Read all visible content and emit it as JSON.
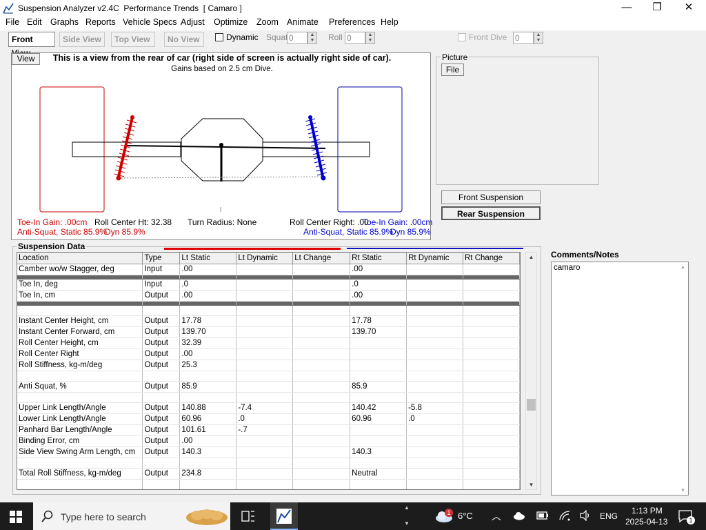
{
  "window": {
    "title": "Suspension Analyzer v2.4C  Performance Trends  [ Camaro ]",
    "minimize_glyph": "—",
    "maximize_glyph": "❐",
    "close_glyph": "✕"
  },
  "menu": [
    "File",
    "Edit",
    "Graphs",
    "Reports",
    "Vehicle Specs",
    "Adjust",
    "Optimize",
    "Zoom",
    "Animate",
    "Preferences",
    "Help"
  ],
  "toolbar": {
    "view_tabs": [
      "Front View",
      "Side View",
      "Top View",
      "No View"
    ],
    "active_view": "Front View",
    "dynamic_label": "Dynamic",
    "dynamic_checked": false,
    "squat_label": "Squat",
    "squat_value": "0",
    "roll_label": "Roll",
    "roll_value": "0",
    "front_dive_label": "Front Dive",
    "front_dive_value": "0"
  },
  "diagram": {
    "view_button": "View",
    "heading": "This is a view from the rear of car (right side of screen is actually right side of car).",
    "subheading": "Gains based on 2.5 cm Dive.",
    "left_toe_gain": "Toe-In Gain: .00cm",
    "roll_center_ht": "Roll Center Ht: 32.38",
    "turn_radius": "Turn Radius: None",
    "roll_center_right": "Roll Center Right: .00",
    "right_toe_gain": "Toe-In Gain: .00cm",
    "left_anti_squat": "Anti-Squat, Static 85.9%",
    "left_dyn": "Dyn 85.9%",
    "right_anti_squat": "Anti-Squat, Static 85.9%",
    "right_dyn": "Dyn 85.9%",
    "left_color": "#cc0000",
    "right_color": "#0000cc"
  },
  "picture": {
    "label": "Picture",
    "file_button": "File"
  },
  "buttons": {
    "front_suspension": "Front Suspension",
    "rear_suspension": "Rear Suspension"
  },
  "suspension_data": {
    "title": "Suspension Data",
    "columns": [
      "Location",
      "Type",
      "Lt Static",
      "Lt Dynamic",
      "Lt Change",
      "Rt Static",
      "Rt Dynamic",
      "Rt Change"
    ],
    "rows": [
      {
        "kind": "data",
        "cells": [
          "Camber wo/w Stagger, deg",
          "Input",
          ".00",
          "",
          "",
          ".00",
          "",
          ""
        ]
      },
      {
        "kind": "divider"
      },
      {
        "kind": "data",
        "cells": [
          "Toe In, deg",
          "Input",
          ".0",
          "",
          "",
          ".0",
          "",
          ""
        ]
      },
      {
        "kind": "data",
        "cells": [
          "Toe In, cm",
          "Output",
          ".00",
          "",
          "",
          ".00",
          "",
          ""
        ]
      },
      {
        "kind": "divider"
      },
      {
        "kind": "spacer"
      },
      {
        "kind": "data",
        "cells": [
          "Instant Center Height, cm",
          "Output",
          "17.78",
          "",
          "",
          "17.78",
          "",
          ""
        ]
      },
      {
        "kind": "data",
        "cells": [
          "Instant Center Forward, cm",
          "Output",
          "139.70",
          "",
          "",
          "139.70",
          "",
          ""
        ]
      },
      {
        "kind": "data",
        "cells": [
          "Roll Center Height, cm",
          "Output",
          "32.39",
          "",
          "",
          "",
          "",
          ""
        ]
      },
      {
        "kind": "data",
        "cells": [
          "Roll Center Right",
          "Output",
          ".00",
          "",
          "",
          "",
          "",
          ""
        ]
      },
      {
        "kind": "data",
        "cells": [
          "Roll Stiffness, kg-m/deg",
          "Output",
          "25.3",
          "",
          "",
          "",
          "",
          ""
        ]
      },
      {
        "kind": "spacer"
      },
      {
        "kind": "data",
        "cells": [
          "Anti Squat, %",
          "Output",
          "85.9",
          "",
          "",
          "85.9",
          "",
          ""
        ]
      },
      {
        "kind": "spacer"
      },
      {
        "kind": "data",
        "cells": [
          "Upper Link Length/Angle",
          "Output",
          "140.88",
          "-7.4",
          "",
          "140.42",
          "-5.8",
          ""
        ]
      },
      {
        "kind": "data",
        "cells": [
          "Lower Link Length/Angle",
          "Output",
          "60.96",
          ".0",
          "",
          "60.96",
          ".0",
          ""
        ]
      },
      {
        "kind": "data",
        "cells": [
          "Panhard Bar Length/Angle",
          "Output",
          "101.61",
          "-.7",
          "",
          "",
          "",
          ""
        ]
      },
      {
        "kind": "data",
        "cells": [
          "Binding Error, cm",
          "Output",
          ".00",
          "",
          "",
          "",
          "",
          ""
        ]
      },
      {
        "kind": "data",
        "cells": [
          "Side View Swing Arm Length, cm",
          "Output",
          "140.3",
          "",
          "",
          "140.3",
          "",
          ""
        ]
      },
      {
        "kind": "spacer"
      },
      {
        "kind": "data",
        "cells": [
          "Total Roll Stiffness, kg-m/deg",
          "Output",
          "234.8",
          "",
          "",
          "Neutral",
          "",
          ""
        ]
      },
      {
        "kind": "spacer"
      }
    ]
  },
  "comments": {
    "label": "Comments/Notes",
    "text": "camaro"
  },
  "taskbar": {
    "search_placeholder": "Type here to search",
    "weather_temp": "6°C",
    "weather_badge": "1",
    "language": "ENG",
    "time": "1:13 PM",
    "date": "2025-04-13",
    "notification_count": "1"
  }
}
